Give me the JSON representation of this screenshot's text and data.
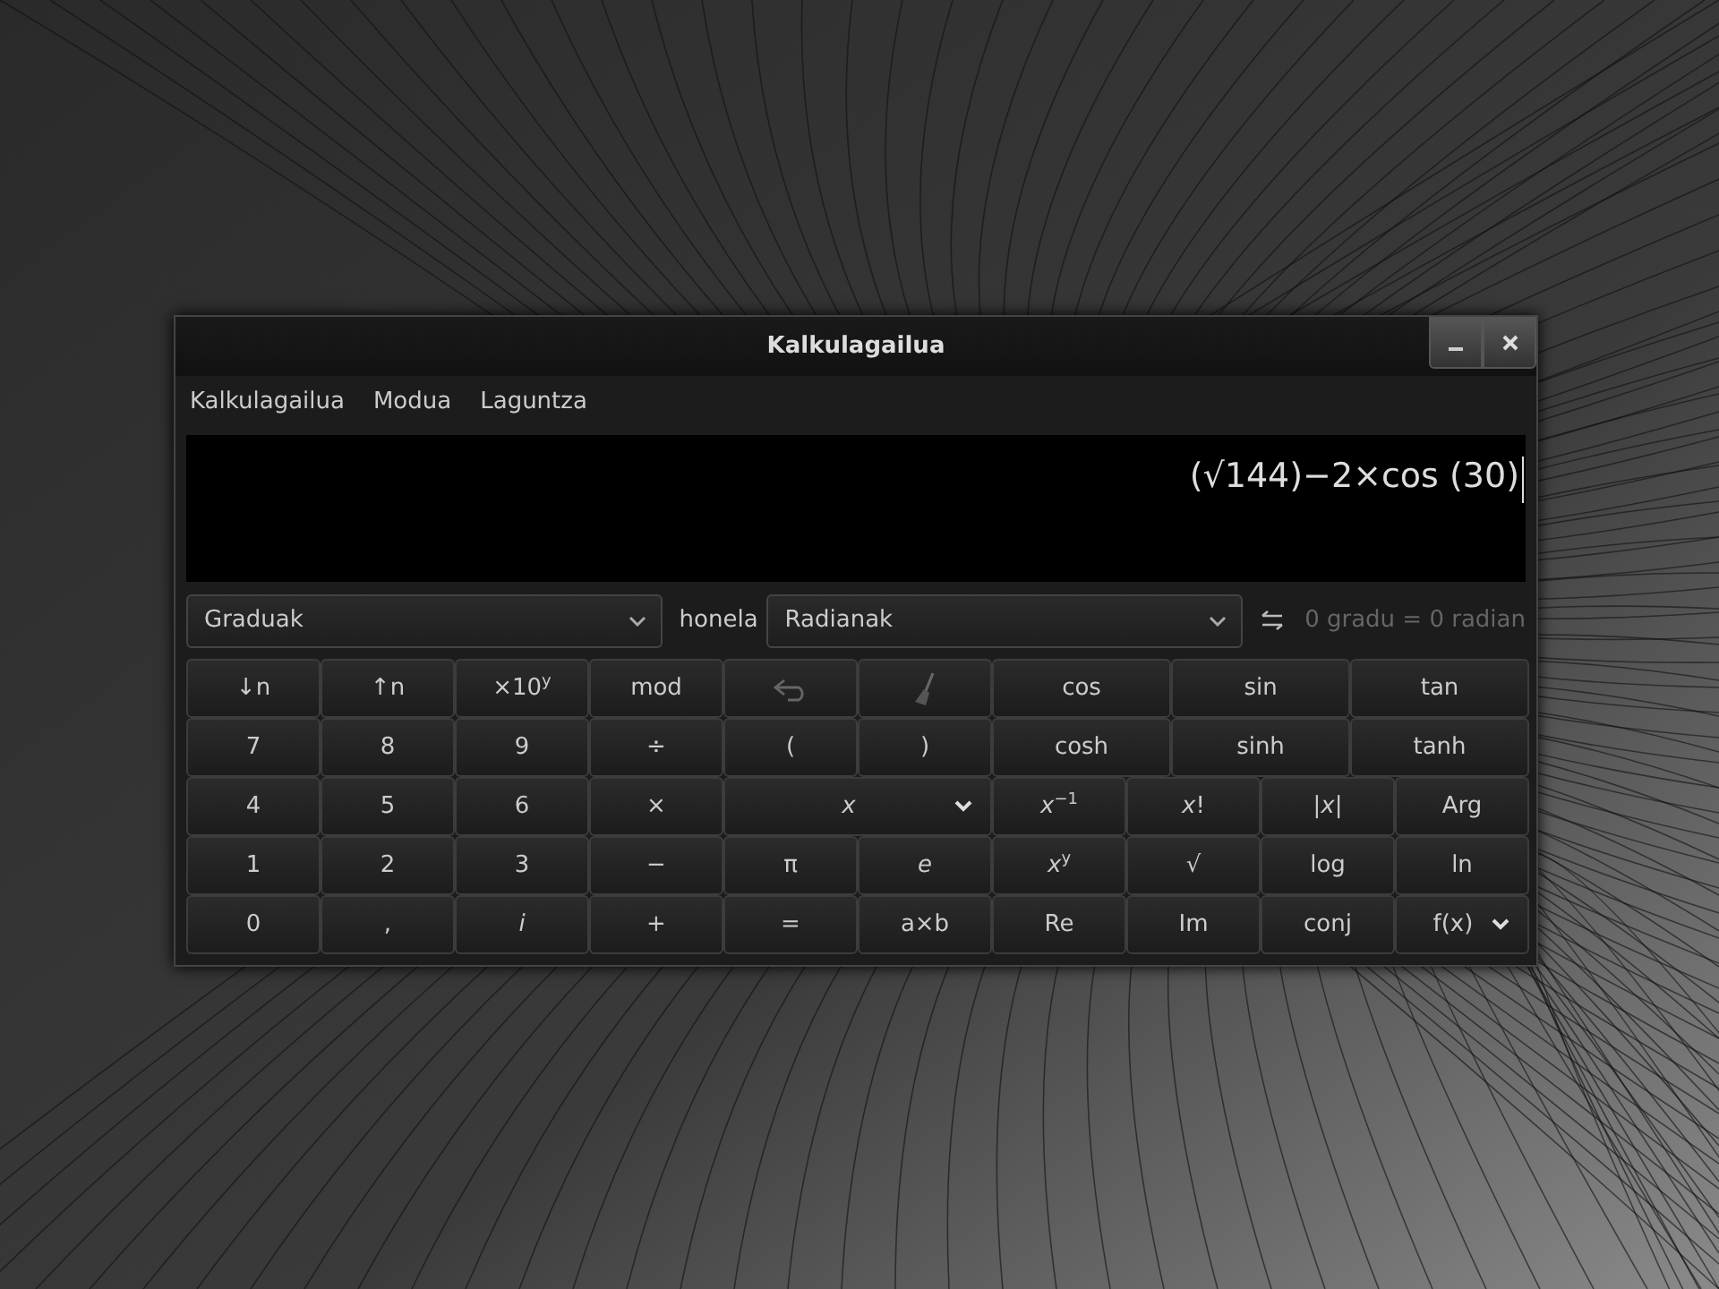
{
  "window": {
    "title": "Kalkulagailua"
  },
  "menu": [
    "Kalkulagailua",
    "Modua",
    "Laguntza"
  ],
  "display": {
    "expression": "(√144)−2×cos (30)"
  },
  "conversion": {
    "from": "Graduak",
    "joiner": "honela",
    "to": "Radianak",
    "result": "0 gradu = 0 radian"
  },
  "keypad": [
    [
      {
        "kind": "text",
        "label": "↓n"
      },
      {
        "kind": "text",
        "label": "↑n"
      },
      {
        "kind": "rich",
        "label": "×10$^{y}$"
      },
      {
        "kind": "text",
        "label": "mod"
      },
      {
        "kind": "undo-icon"
      },
      {
        "kind": "broom-icon"
      },
      {
        "kind": "text",
        "label": "cos"
      },
      {
        "kind": "text",
        "label": "sin"
      },
      {
        "kind": "text",
        "label": "tan"
      }
    ],
    [
      {
        "kind": "text",
        "label": "7"
      },
      {
        "kind": "text",
        "label": "8"
      },
      {
        "kind": "text",
        "label": "9"
      },
      {
        "kind": "text",
        "label": "÷"
      },
      {
        "kind": "text",
        "label": "("
      },
      {
        "kind": "text",
        "label": ")"
      },
      {
        "kind": "text",
        "label": "cosh"
      },
      {
        "kind": "text",
        "label": "sinh"
      },
      {
        "kind": "text",
        "label": "tanh"
      }
    ],
    [
      {
        "kind": "text",
        "label": "4"
      },
      {
        "kind": "text",
        "label": "5"
      },
      {
        "kind": "text",
        "label": "6"
      },
      {
        "kind": "text",
        "label": "×"
      },
      {
        "kind": "variable",
        "label": "x"
      },
      {
        "kind": "rich",
        "label": "*x*$^{−1}$"
      },
      {
        "kind": "rich",
        "label": "*x*!"
      },
      {
        "kind": "rich",
        "label": "|*x*|"
      },
      {
        "kind": "text",
        "label": "Arg"
      }
    ],
    [
      {
        "kind": "text",
        "label": "1"
      },
      {
        "kind": "text",
        "label": "2"
      },
      {
        "kind": "text",
        "label": "3"
      },
      {
        "kind": "text",
        "label": "−"
      },
      {
        "kind": "text",
        "label": "π"
      },
      {
        "kind": "italic",
        "label": "e"
      },
      {
        "kind": "rich",
        "label": "*x*$^{y}$"
      },
      {
        "kind": "text",
        "label": "√"
      },
      {
        "kind": "text",
        "label": "log"
      },
      {
        "kind": "text",
        "label": "ln"
      }
    ],
    [
      {
        "kind": "text",
        "label": "0"
      },
      {
        "kind": "text",
        "label": ","
      },
      {
        "kind": "italic",
        "label": "i"
      },
      {
        "kind": "text",
        "label": "+"
      },
      {
        "kind": "text",
        "label": "="
      },
      {
        "kind": "text",
        "label": "a×b"
      },
      {
        "kind": "text",
        "label": "Re"
      },
      {
        "kind": "text",
        "label": "Im"
      },
      {
        "kind": "text",
        "label": "conj"
      },
      {
        "kind": "menu",
        "label": "f(x)"
      }
    ]
  ]
}
